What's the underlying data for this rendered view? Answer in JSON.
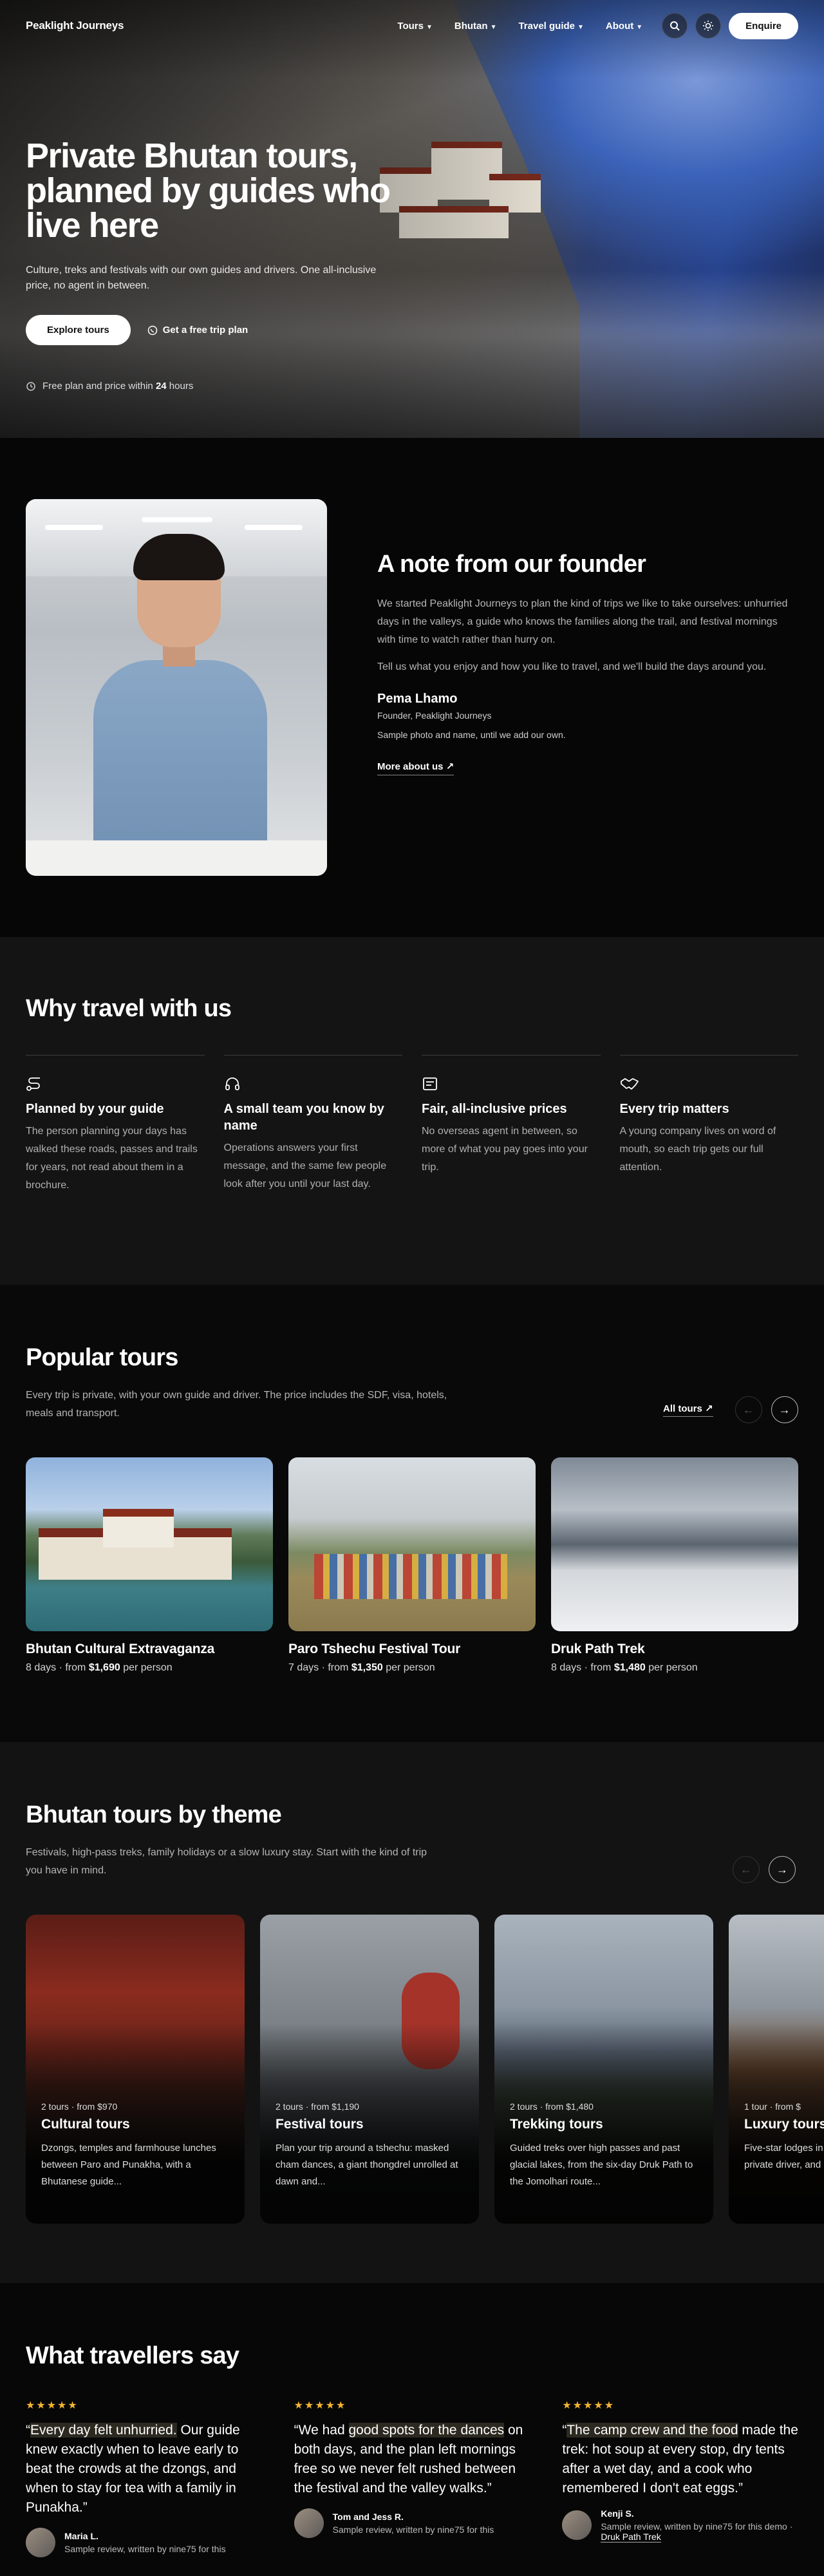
{
  "nav": {
    "logo": "Peaklight Journeys",
    "links": [
      "Tours",
      "Bhutan",
      "Travel guide",
      "About"
    ],
    "enquire": "Enquire"
  },
  "hero": {
    "title": "Private Bhutan tours, planned by guides who live here",
    "subtitle": "Culture, treks and festivals with our own guides and drivers. One all-inclusive price, no agent in between.",
    "explore_button": "Explore tours",
    "plan_button": "Get a free trip plan",
    "note_prefix": "Free plan and price within ",
    "note_bold": "24",
    "note_suffix": " hours"
  },
  "founder": {
    "title": "A note from our founder",
    "paragraph1": "We started Peaklight Journeys to plan the kind of trips we like to take ourselves: unhurried days in the valleys, a guide who knows the families along the trail, and festival mornings with time to watch rather than hurry on.",
    "paragraph2": "Tell us what you enjoy and how you like to travel, and we'll build the days around you.",
    "name": "Pema Lhamo",
    "role": "Founder, Peaklight Journeys",
    "disclaimer": "Sample photo and name, until we add our own.",
    "more_link": "More about us ↗"
  },
  "why": {
    "title": "Why travel with us",
    "items": [
      {
        "icon": "route-icon",
        "title": "Planned by your guide",
        "text": "The person planning your days has walked these roads, passes and trails for years, not read about them in a brochure."
      },
      {
        "icon": "headset-icon",
        "title": "A small team you know by name",
        "text": "Operations answers your first message, and the same few people look after you until your last day."
      },
      {
        "icon": "receipt-icon",
        "title": "Fair, all-inclusive prices",
        "text": "No overseas agent in between, so more of what you pay goes into your trip."
      },
      {
        "icon": "handshake-icon",
        "title": "Every trip matters",
        "text": "A young company lives on word of mouth, so each trip gets our full attention."
      }
    ]
  },
  "popular": {
    "title": "Popular tours",
    "lead": "Every trip is private, with your own guide and driver. The price includes the SDF, visa, hotels, meals and transport.",
    "all_link": "All tours ↗",
    "tours": [
      {
        "name": "Bhutan Cultural Extravaganza",
        "days": "8 days · from ",
        "price": "$1,690",
        "suffix": " per person"
      },
      {
        "name": "Paro Tshechu Festival Tour",
        "days": "7 days · from ",
        "price": "$1,350",
        "suffix": " per person"
      },
      {
        "name": "Druk Path Trek",
        "days": "8 days · from ",
        "price": "$1,480",
        "suffix": " per person"
      }
    ]
  },
  "themes": {
    "title": "Bhutan tours by theme",
    "lead": "Festivals, high-pass treks, family holidays or a slow luxury stay. Start with the kind of trip you have in mind.",
    "cards": [
      {
        "meta": "2 tours · from $970",
        "title": "Cultural tours",
        "desc": "Dzongs, temples and farmhouse lunches between Paro and Punakha, with a Bhutanese guide..."
      },
      {
        "meta": "2 tours · from $1,190",
        "title": "Festival tours",
        "desc": "Plan your trip around a tshechu: masked cham dances, a giant thongdrel unrolled at dawn and..."
      },
      {
        "meta": "2 tours · from $1,480",
        "title": "Trekking tours",
        "desc": "Guided treks over high passes and past glacial lakes, from the six-day Druk Path to the Jomolhari route..."
      },
      {
        "meta": "1 tour · from $",
        "title": "Luxury tours",
        "desc": "Five-star lodges in Paro and Thimphu, a private driver, and days..."
      }
    ]
  },
  "reviews": {
    "title": "What travellers say",
    "stars": "★★★★★",
    "items": [
      {
        "quote_pre": "“",
        "quote_hl": "Every day felt unhurried.",
        "quote_post": " Our guide knew exactly when to leave early to beat the crowds at the dzongs, and when to stay for tea with a family in Punakha.”",
        "name": "Maria L.",
        "note": "Sample review, written by nine75 for this"
      },
      {
        "quote_pre": "“We had ",
        "quote_hl": "good spots for the dances",
        "quote_post": " on both days, and the plan left mornings free so we never felt rushed between the festival and the valley walks.”",
        "name": "Tom and Jess R.",
        "note": "Sample review, written by nine75 for this"
      },
      {
        "quote_pre": "“",
        "quote_hl": "The camp crew and the food",
        "quote_post": " made the trek: hot soup at every stop, dry tents after a wet day, and a cook who remembered I don't eat eggs.”",
        "name": "Kenji S.",
        "note": "Sample review, written by nine75 for this demo · ",
        "link": "Druk Path Trek"
      }
    ]
  },
  "colors": {
    "accent_star": "#f2b530",
    "background": "#0a0a0a"
  }
}
